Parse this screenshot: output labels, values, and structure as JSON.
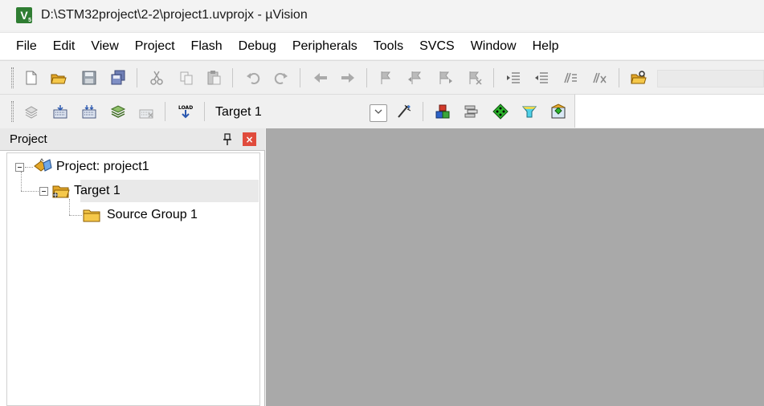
{
  "window": {
    "title": "D:\\STM32project\\2-2\\project1.uvprojx - µVision",
    "logo_text": "V",
    "logo_sub": "5"
  },
  "menu": [
    "File",
    "Edit",
    "View",
    "Project",
    "Flash",
    "Debug",
    "Peripherals",
    "Tools",
    "SVCS",
    "Window",
    "Help"
  ],
  "toolbar2": {
    "target_name": "Target 1"
  },
  "project_panel": {
    "title": "Project",
    "close_glyph": "×",
    "tree": {
      "root": "Project: project1",
      "target": "Target 1",
      "group": "Source Group 1"
    }
  },
  "colors": {
    "editor_bg": "#a9a9a9",
    "close_button": "#e04b3c",
    "logo": "#2f7d32"
  }
}
